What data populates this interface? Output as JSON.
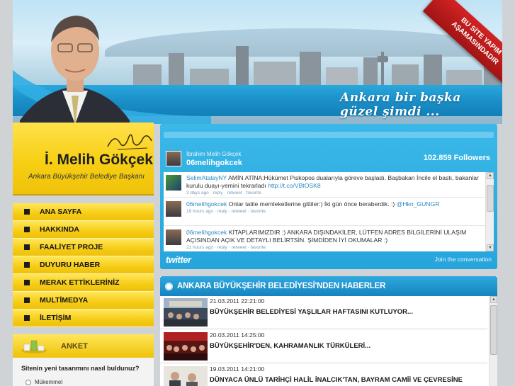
{
  "header": {
    "slogan": "Ankara bir başka güzel şimdi ...",
    "ribbon_line1": "BU SİTE YAPIM",
    "ribbon_line2": "AŞAMASINDADIR"
  },
  "profile": {
    "name": "İ. Melih Gökçek",
    "title": "Ankara Büyükşehir Belediye Başkanı"
  },
  "nav": {
    "items": [
      {
        "label": "ANA SAYFA"
      },
      {
        "label": "HAKKINDA"
      },
      {
        "label": "FAALİYET PROJE"
      },
      {
        "label": "DUYURU HABER"
      },
      {
        "label": "MERAK ETTİKLERİNİZ"
      },
      {
        "label": "MULTİMEDYA"
      },
      {
        "label": "İLETİŞİM"
      }
    ]
  },
  "poll": {
    "title": "ANKET",
    "question": "Sitenin yeni tasarımını nasıl buldunuz?",
    "option1": "Mükemmel"
  },
  "twitter": {
    "real_name": "İbrahim Melih Gökçek",
    "handle": "06melihgokcek",
    "followers": "102.859 Followers",
    "tweets": [
      {
        "user": "SelimAtalayNY",
        "text": " AMİN ATİNA:Hükümet Piskopos dualarıyla göreve başladı. Başbakan İncile el bastı, bakanlar kurulu duayı-yemini tekrarladı ",
        "link": "http://t.co/VBtOSK8",
        "meta": "3 days ago · reply · retweet · favorite"
      },
      {
        "user": "06melihgokcek",
        "text": " Onlar tatile memleketlerine gittiler:) İki gün önce beraberdik. :) ",
        "link": "@Hkn_GUNGR",
        "meta": "19 hours ago · reply · retweet · favorite"
      },
      {
        "user": "06melihgokcek",
        "text": " KİTAPLARIMIZDIR :) ANKARA DIŞINDAKİLER, LÜTFEN ADRES BİLGİLERİNİ ULAŞIM AÇISINDAN AÇIK VE DETAYLI BELİRTSİN. ŞİMDİDEN İYİ OKUMALAR :)",
        "link": "",
        "meta": "21 hours ago · reply · retweet · favorite"
      }
    ],
    "logo": "twitter",
    "join": "Join the conversation"
  },
  "news": {
    "title": "ANKARA BÜYÜKŞEHİR BELEDİYESİ'NDEN HABERLER",
    "items": [
      {
        "date": "21.03.2011 22:21:00",
        "headline": "BÜYÜKŞEHİR BELEDİYESİ YAŞLILAR HAFTASINI KUTLUYOR..."
      },
      {
        "date": "20.03.2011 14:25:00",
        "headline": "BÜYÜKŞEHİR'DEN, KAHRAMANLIK TÜRKÜLERİ..."
      },
      {
        "date": "19.03.2011 14:21:00",
        "headline": "DÜNYACA ÜNLÜ TARİHÇİ HALİL İNALCIK'TAN, BAYRAM CAMİİ VE ÇEVRESİNE"
      }
    ]
  }
}
